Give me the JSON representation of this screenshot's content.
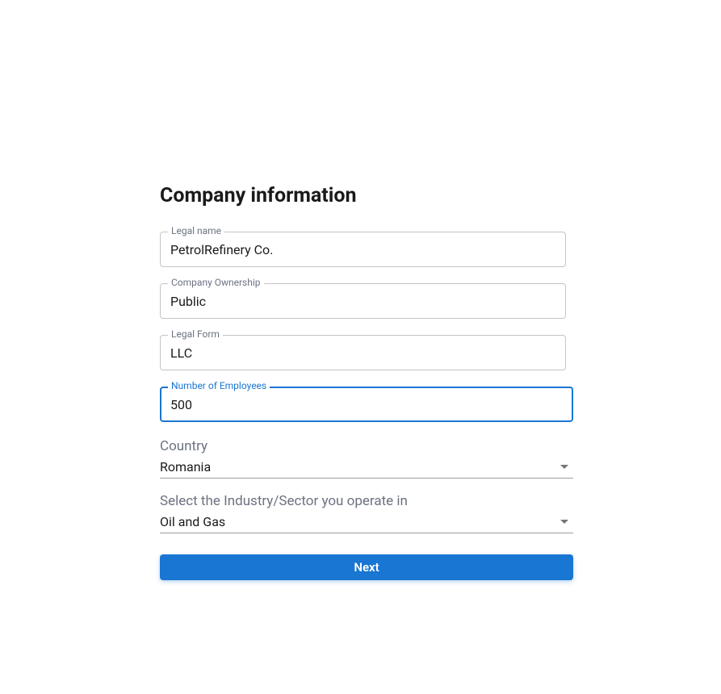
{
  "form": {
    "title": "Company information",
    "fields": {
      "legalName": {
        "label": "Legal name",
        "value": "PetrolRefinery Co."
      },
      "companyOwnership": {
        "label": "Company Ownership",
        "value": "Public"
      },
      "legalForm": {
        "label": "Legal Form",
        "value": "LLC"
      },
      "numberOfEmployees": {
        "label": "Number of Employees",
        "value": "500"
      },
      "country": {
        "label": "Country",
        "value": "Romania"
      },
      "industry": {
        "label": "Select the Industry/Sector you operate in",
        "value": "Oil and Gas"
      }
    },
    "nextButton": "Next"
  }
}
